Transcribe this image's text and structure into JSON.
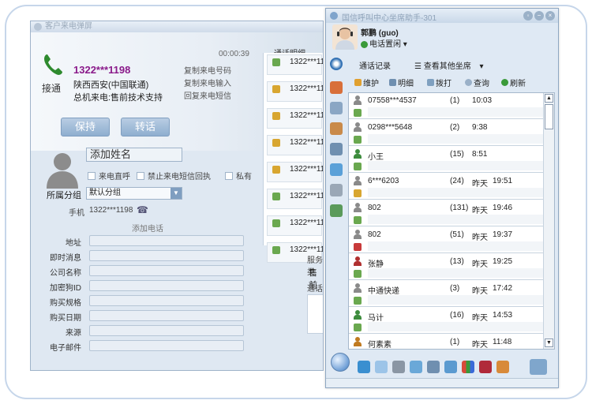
{
  "popup": {
    "title": "客户来电弹屏",
    "timer": "00:00:39",
    "answer_label": "接通",
    "caller_number": "1322***1198",
    "caller_region": "陕西西安(中国联通)",
    "caller_dept": "总机来电:售前技术支持",
    "copy_links": [
      "复制来电号码",
      "复制来电输入",
      "回复来电短信"
    ],
    "hold_button": "保持",
    "transfer_button": "转话",
    "call_list_header": "通话明细",
    "call_rows": [
      "1322***11",
      "1322***11",
      "1322***11",
      "1322***11",
      "1322***11",
      "1322***11",
      "1322***11",
      "1322***11"
    ],
    "name_placeholder": "添加姓名",
    "checks": [
      "来电直呼",
      "禁止来电短信回执",
      "私有"
    ],
    "group_label": "所属分组",
    "group_value": "默认分组",
    "mobile_label": "手机",
    "mobile_value": "1322***1198",
    "add_phone": "添加电话",
    "fields": [
      "地址",
      "即时消息",
      "公司名称",
      "加密狗ID",
      "购买规格",
      "购买日期",
      "来源",
      "电子邮件"
    ],
    "service_label": "服务类",
    "service_value": "售前",
    "record_label": "通话记"
  },
  "assistant": {
    "title": "国信呼叫中心坐席助手-301",
    "user_name": "郭鹏 (guo)",
    "status": "电话置闲",
    "tabs": [
      "通话记录",
      "查看其他坐席"
    ],
    "toolbar": [
      "维护",
      "明细",
      "拨打",
      "查询",
      "刷新"
    ],
    "records": [
      {
        "name": "07558***4537",
        "count": "(1)",
        "day": "",
        "time": "10:03",
        "color": "#8a8a8a"
      },
      {
        "name": "0298***5648",
        "count": "(2)",
        "day": "",
        "time": "9:38",
        "color": "#8a8a8a"
      },
      {
        "name": "小王",
        "count": "(15)",
        "day": "",
        "time": "8:51",
        "color": "#3d8c3d"
      },
      {
        "name": "6***6203",
        "count": "(24)",
        "day": "昨天",
        "time": "19:51",
        "color": "#8a8a8a"
      },
      {
        "name": "802",
        "count": "(131)",
        "day": "昨天",
        "time": "19:46",
        "color": "#8a8a8a"
      },
      {
        "name": "802",
        "count": "(51)",
        "day": "昨天",
        "time": "19:37",
        "color": "#8a8a8a"
      },
      {
        "name": "张静",
        "count": "(13)",
        "day": "昨天",
        "time": "19:25",
        "color": "#b03030"
      },
      {
        "name": "中通快递",
        "count": "(3)",
        "day": "昨天",
        "time": "17:42",
        "color": "#8a8a8a"
      },
      {
        "name": "马计",
        "count": "(16)",
        "day": "昨天",
        "time": "14:53",
        "color": "#3d8c3d"
      },
      {
        "name": "何素素",
        "count": "(1)",
        "day": "昨天",
        "time": "11:48",
        "color": "#c07a20"
      }
    ]
  }
}
